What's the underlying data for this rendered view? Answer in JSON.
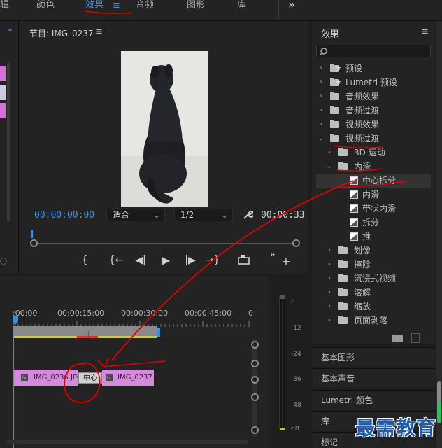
{
  "workspaces": {
    "cut_off": "辑",
    "color": "颜色",
    "effects": "效果",
    "effects_menu": "≡",
    "audio": "音频",
    "graphics": "图形",
    "libraries": "库",
    "more": "»"
  },
  "program": {
    "title": "节目: IMG_0237",
    "menu": "≡",
    "timecode_in": "00:00:00:00",
    "fit": "适合",
    "resolution": "1/2",
    "timecode_out": "00:00:33",
    "controls": [
      "{",
      "{←",
      "◀|",
      "▶",
      "|▶",
      "→}",
      "",
      "»",
      "+"
    ]
  },
  "timeline": {
    "ruler": [
      ":00:00",
      "00:00:15:00",
      "00:00:30:00",
      "00:00:45:00",
      "0"
    ],
    "clip_a": "IMG_0236.JPG",
    "clip_b": "IMG_0237.J",
    "transition": "中心",
    "fx": "fx"
  },
  "meter": {
    "ticks": [
      "0",
      "-12",
      "-24",
      "-36",
      "-48",
      "dB"
    ]
  },
  "effects": {
    "title": "效果",
    "menu": "≡",
    "tree": [
      {
        "label": "预设",
        "arrow": "›",
        "kind": "star"
      },
      {
        "label": "Lumetri 预设",
        "arrow": "›",
        "kind": "star"
      },
      {
        "label": "音频效果",
        "arrow": "›",
        "kind": "folder"
      },
      {
        "label": "音频过渡",
        "arrow": "›",
        "kind": "folder"
      },
      {
        "label": "视频效果",
        "arrow": "›",
        "kind": "folder"
      },
      {
        "label": "视频过渡",
        "arrow": "⌄",
        "kind": "folder"
      },
      {
        "label": "3D 运动",
        "arrow": "›",
        "kind": "folder"
      },
      {
        "label": "内滑",
        "arrow": "⌄",
        "kind": "folder"
      },
      {
        "label": "中心拆分",
        "arrow": "",
        "kind": "fx"
      },
      {
        "label": "内滑",
        "arrow": "",
        "kind": "fx"
      },
      {
        "label": "带状内滑",
        "arrow": "",
        "kind": "fx"
      },
      {
        "label": "拆分",
        "arrow": "",
        "kind": "fx"
      },
      {
        "label": "推",
        "arrow": "",
        "kind": "fx"
      },
      {
        "label": "划像",
        "arrow": "›",
        "kind": "folder"
      },
      {
        "label": "擦除",
        "arrow": "›",
        "kind": "folder"
      },
      {
        "label": "沉浸式视频",
        "arrow": "›",
        "kind": "folder"
      },
      {
        "label": "溶解",
        "arrow": "›",
        "kind": "folder"
      },
      {
        "label": "缩放",
        "arrow": "›",
        "kind": "folder"
      },
      {
        "label": "页面剥落",
        "arrow": "›",
        "kind": "folder"
      }
    ]
  },
  "sections": [
    "基本图形",
    "基本声音",
    "Lumetri 颜色",
    "库",
    "标记"
  ],
  "watermark": "最需教育",
  "colors": {
    "accent": "#3a8ee6",
    "clip": "#d48bdc",
    "annotation": "#e00000",
    "work_area": "#c8c84a"
  }
}
